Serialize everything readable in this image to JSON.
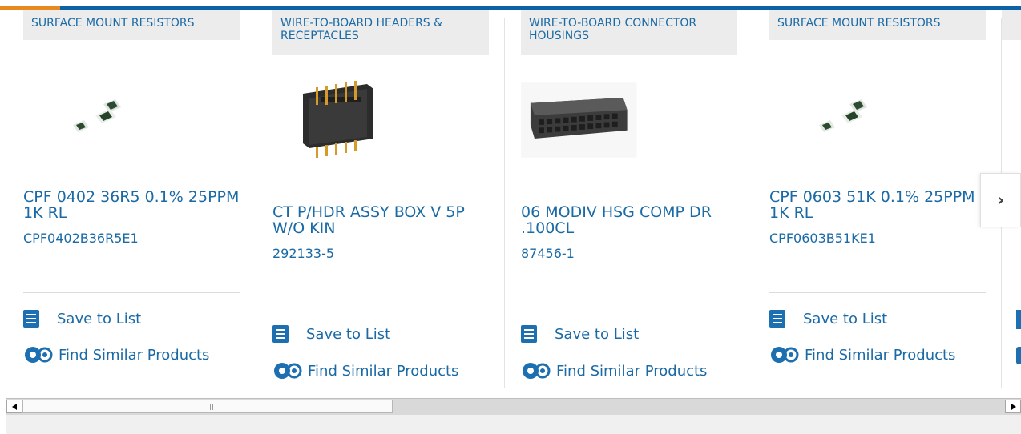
{
  "cards": [
    {
      "category": "SURFACE MOUNT RESISTORS",
      "title": "CPF 0402 36R5 0.1% 25PPM 1K RL",
      "part_number": "CPF0402B36R5E1",
      "save_label": "Save to List",
      "similar_label": "Find Similar Products",
      "image": "smd-resistor-image"
    },
    {
      "category": "WIRE-TO-BOARD HEADERS & RECEPTACLES",
      "title": "CT P/HDR ASSY BOX V 5P W/O KIN",
      "part_number": "292133-5",
      "save_label": "Save to List",
      "similar_label": "Find Similar Products",
      "image": "pin-header-image"
    },
    {
      "category": "WIRE-TO-BOARD CONNECTOR HOUSINGS",
      "title": "06 MODIV HSG COMP DR .100CL",
      "part_number": "87456-1",
      "save_label": "Save to List",
      "similar_label": "Find Similar Products",
      "image": "connector-housing-image"
    },
    {
      "category": "SURFACE MOUNT RESISTORS",
      "title": "CPF 0603 51K 0.1% 25PPM 1K RL",
      "part_number": "CPF0603B51KE1",
      "save_label": "Save to List",
      "similar_label": "Find Similar Products",
      "image": "smd-resistor-image"
    }
  ],
  "carousel": {
    "next_icon": "chevron-right-icon",
    "next_glyph": "›"
  },
  "colors": {
    "accent": "#e68a1f",
    "brand": "#0c62a4",
    "link": "#1a6aa6"
  }
}
